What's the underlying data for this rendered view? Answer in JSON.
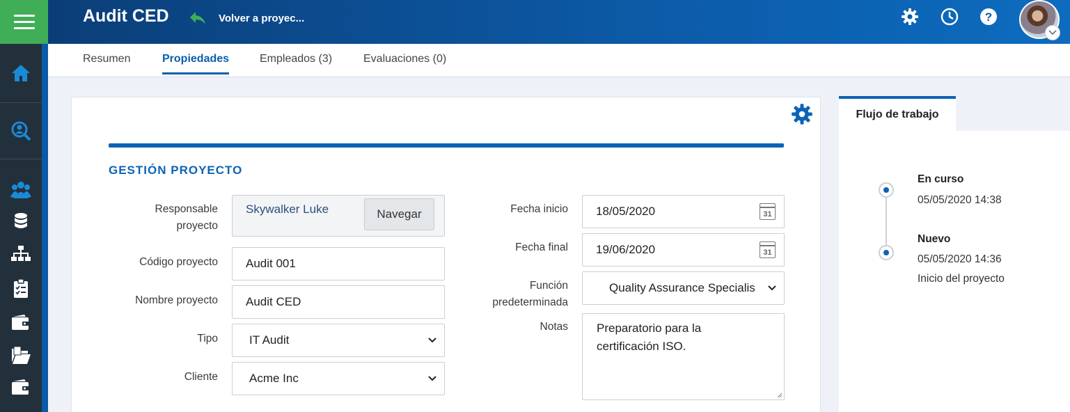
{
  "header": {
    "title": "Audit CED",
    "back_label": "Volver a proyec...",
    "icons": [
      "gear-icon",
      "clock-icon",
      "help-icon"
    ],
    "accent": "#0c5ba8",
    "menu_color": "#3fae57"
  },
  "sidebar": {
    "items": [
      "home-icon",
      "search-user-icon",
      "team-icon",
      "database-icon",
      "org-chart-icon",
      "checklist-icon",
      "wallet-icon",
      "folder-icon",
      "wallet-icon"
    ]
  },
  "tabs": [
    {
      "label": "Resumen"
    },
    {
      "label": "Propiedades",
      "active": true
    },
    {
      "label": "Empleados (3)"
    },
    {
      "label": "Evaluaciones (0)"
    }
  ],
  "form": {
    "section_title": "GESTIÓN PROYECTO",
    "responsable": {
      "label_1": "Responsable",
      "label_2": "proyecto",
      "value": "Skywalker Luke",
      "button": "Navegar"
    },
    "codigo": {
      "label": "Código proyecto",
      "value": "Audit 001"
    },
    "nombre": {
      "label": "Nombre proyecto",
      "value": "Audit CED"
    },
    "tipo": {
      "label": "Tipo",
      "value": "IT Audit"
    },
    "cliente": {
      "label": "Cliente",
      "value": "Acme Inc"
    },
    "fecha_inicio": {
      "label": "Fecha inicio",
      "value": "18/05/2020",
      "cal_day": "31"
    },
    "fecha_final": {
      "label": "Fecha final",
      "value": "19/06/2020",
      "cal_day": "31"
    },
    "funcion": {
      "label_1": "Función",
      "label_2": "predeterminada",
      "value": "Quality Assurance Specialis"
    },
    "notas": {
      "label": "Notas",
      "line_1": "Preparatorio para la",
      "line_2": "certificación ISO."
    }
  },
  "workflow": {
    "tab_label": "Flujo de trabajo",
    "steps": [
      {
        "status": "En curso",
        "date": "05/05/2020 14:38"
      },
      {
        "status": "Nuevo",
        "date": "05/05/2020 14:36",
        "note": "Inicio del proyecto"
      }
    ]
  }
}
